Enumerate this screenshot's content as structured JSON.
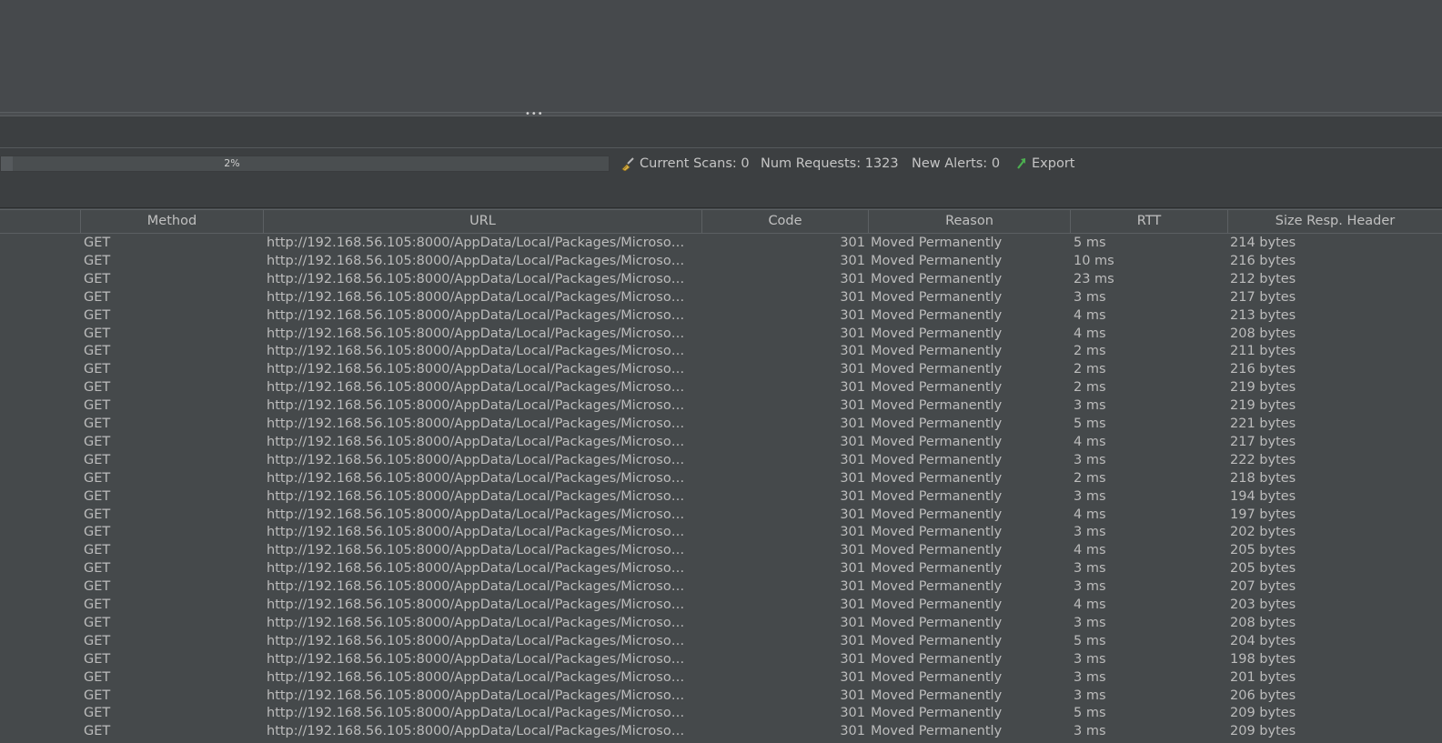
{
  "splitter": {
    "grip": "•••"
  },
  "status": {
    "progress_label": "2%",
    "progress_fraction": 0.02,
    "current_scans_label": "Current Scans:",
    "current_scans_value": "0",
    "num_requests_label": "Num Requests:",
    "num_requests_value": "1323",
    "new_alerts_label": "New Alerts:",
    "new_alerts_value": "0",
    "export_label": "Export"
  },
  "table": {
    "columns": [
      "Method",
      "URL",
      "Code",
      "Reason",
      "RTT",
      "Size Resp. Header"
    ],
    "rows": [
      {
        "method": "GET",
        "url": "http://192.168.56.105:8000/AppData/Local/Packages/Microso…",
        "code": "301",
        "reason": "Moved Permanently",
        "rtt": "5 ms",
        "size": "214 bytes"
      },
      {
        "method": "GET",
        "url": "http://192.168.56.105:8000/AppData/Local/Packages/Microso…",
        "code": "301",
        "reason": "Moved Permanently",
        "rtt": "10 ms",
        "size": "216 bytes"
      },
      {
        "method": "GET",
        "url": "http://192.168.56.105:8000/AppData/Local/Packages/Microso…",
        "code": "301",
        "reason": "Moved Permanently",
        "rtt": "23 ms",
        "size": "212 bytes"
      },
      {
        "method": "GET",
        "url": "http://192.168.56.105:8000/AppData/Local/Packages/Microso…",
        "code": "301",
        "reason": "Moved Permanently",
        "rtt": "3 ms",
        "size": "217 bytes"
      },
      {
        "method": "GET",
        "url": "http://192.168.56.105:8000/AppData/Local/Packages/Microso…",
        "code": "301",
        "reason": "Moved Permanently",
        "rtt": "4 ms",
        "size": "213 bytes"
      },
      {
        "method": "GET",
        "url": "http://192.168.56.105:8000/AppData/Local/Packages/Microso…",
        "code": "301",
        "reason": "Moved Permanently",
        "rtt": "4 ms",
        "size": "208 bytes"
      },
      {
        "method": "GET",
        "url": "http://192.168.56.105:8000/AppData/Local/Packages/Microso…",
        "code": "301",
        "reason": "Moved Permanently",
        "rtt": "2 ms",
        "size": "211 bytes"
      },
      {
        "method": "GET",
        "url": "http://192.168.56.105:8000/AppData/Local/Packages/Microso…",
        "code": "301",
        "reason": "Moved Permanently",
        "rtt": "2 ms",
        "size": "216 bytes"
      },
      {
        "method": "GET",
        "url": "http://192.168.56.105:8000/AppData/Local/Packages/Microso…",
        "code": "301",
        "reason": "Moved Permanently",
        "rtt": "2 ms",
        "size": "219 bytes"
      },
      {
        "method": "GET",
        "url": "http://192.168.56.105:8000/AppData/Local/Packages/Microso…",
        "code": "301",
        "reason": "Moved Permanently",
        "rtt": "3 ms",
        "size": "219 bytes"
      },
      {
        "method": "GET",
        "url": "http://192.168.56.105:8000/AppData/Local/Packages/Microso…",
        "code": "301",
        "reason": "Moved Permanently",
        "rtt": "5 ms",
        "size": "221 bytes"
      },
      {
        "method": "GET",
        "url": "http://192.168.56.105:8000/AppData/Local/Packages/Microso…",
        "code": "301",
        "reason": "Moved Permanently",
        "rtt": "4 ms",
        "size": "217 bytes"
      },
      {
        "method": "GET",
        "url": "http://192.168.56.105:8000/AppData/Local/Packages/Microso…",
        "code": "301",
        "reason": "Moved Permanently",
        "rtt": "3 ms",
        "size": "222 bytes"
      },
      {
        "method": "GET",
        "url": "http://192.168.56.105:8000/AppData/Local/Packages/Microso…",
        "code": "301",
        "reason": "Moved Permanently",
        "rtt": "2 ms",
        "size": "218 bytes"
      },
      {
        "method": "GET",
        "url": "http://192.168.56.105:8000/AppData/Local/Packages/Microso…",
        "code": "301",
        "reason": "Moved Permanently",
        "rtt": "3 ms",
        "size": "194 bytes"
      },
      {
        "method": "GET",
        "url": "http://192.168.56.105:8000/AppData/Local/Packages/Microso…",
        "code": "301",
        "reason": "Moved Permanently",
        "rtt": "4 ms",
        "size": "197 bytes"
      },
      {
        "method": "GET",
        "url": "http://192.168.56.105:8000/AppData/Local/Packages/Microso…",
        "code": "301",
        "reason": "Moved Permanently",
        "rtt": "3 ms",
        "size": "202 bytes"
      },
      {
        "method": "GET",
        "url": "http://192.168.56.105:8000/AppData/Local/Packages/Microso…",
        "code": "301",
        "reason": "Moved Permanently",
        "rtt": "4 ms",
        "size": "205 bytes"
      },
      {
        "method": "GET",
        "url": "http://192.168.56.105:8000/AppData/Local/Packages/Microso…",
        "code": "301",
        "reason": "Moved Permanently",
        "rtt": "3 ms",
        "size": "205 bytes"
      },
      {
        "method": "GET",
        "url": "http://192.168.56.105:8000/AppData/Local/Packages/Microso…",
        "code": "301",
        "reason": "Moved Permanently",
        "rtt": "3 ms",
        "size": "207 bytes"
      },
      {
        "method": "GET",
        "url": "http://192.168.56.105:8000/AppData/Local/Packages/Microso…",
        "code": "301",
        "reason": "Moved Permanently",
        "rtt": "4 ms",
        "size": "203 bytes"
      },
      {
        "method": "GET",
        "url": "http://192.168.56.105:8000/AppData/Local/Packages/Microso…",
        "code": "301",
        "reason": "Moved Permanently",
        "rtt": "3 ms",
        "size": "208 bytes"
      },
      {
        "method": "GET",
        "url": "http://192.168.56.105:8000/AppData/Local/Packages/Microso…",
        "code": "301",
        "reason": "Moved Permanently",
        "rtt": "5 ms",
        "size": "204 bytes"
      },
      {
        "method": "GET",
        "url": "http://192.168.56.105:8000/AppData/Local/Packages/Microso…",
        "code": "301",
        "reason": "Moved Permanently",
        "rtt": "3 ms",
        "size": "198 bytes"
      },
      {
        "method": "GET",
        "url": "http://192.168.56.105:8000/AppData/Local/Packages/Microso…",
        "code": "301",
        "reason": "Moved Permanently",
        "rtt": "3 ms",
        "size": "201 bytes"
      },
      {
        "method": "GET",
        "url": "http://192.168.56.105:8000/AppData/Local/Packages/Microso…",
        "code": "301",
        "reason": "Moved Permanently",
        "rtt": "3 ms",
        "size": "206 bytes"
      },
      {
        "method": "GET",
        "url": "http://192.168.56.105:8000/AppData/Local/Packages/Microso…",
        "code": "301",
        "reason": "Moved Permanently",
        "rtt": "5 ms",
        "size": "209 bytes"
      },
      {
        "method": "GET",
        "url": "http://192.168.56.105:8000/AppData/Local/Packages/Microso…",
        "code": "301",
        "reason": "Moved Permanently",
        "rtt": "3 ms",
        "size": "209 bytes"
      }
    ]
  },
  "icons": {
    "broom": "broom-icon",
    "export": "export-arrow-icon"
  },
  "colors": {
    "background": "#45494b",
    "toolbar": "#3c3f41",
    "export_arrow": "#4caf50"
  }
}
